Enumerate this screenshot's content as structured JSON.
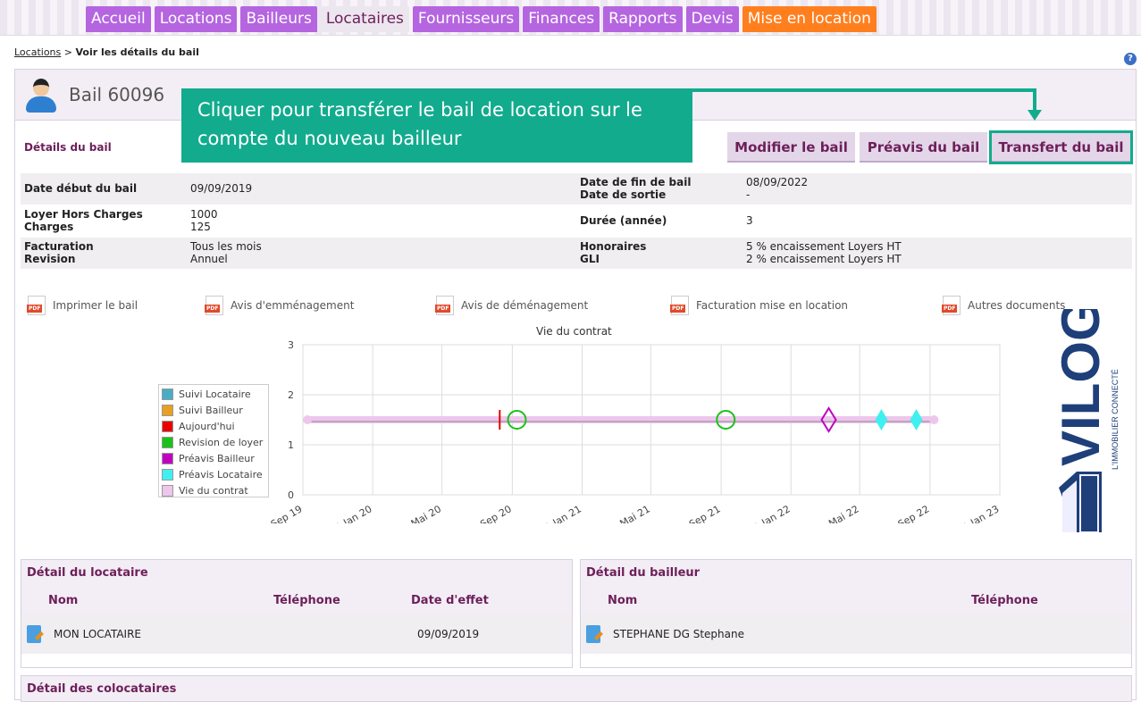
{
  "nav": [
    {
      "label": "Accueil",
      "color": "#b565e0"
    },
    {
      "label": "Locations",
      "color": "#b565e0"
    },
    {
      "label": "Bailleurs",
      "color": "#b565e0"
    },
    {
      "label": "Locataires",
      "color": "#ece6ef",
      "active": true
    },
    {
      "label": "Fournisseurs",
      "color": "#b565e0"
    },
    {
      "label": "Finances",
      "color": "#b565e0"
    },
    {
      "label": "Rapports",
      "color": "#b565e0"
    },
    {
      "label": "Devis",
      "color": "#b565e0"
    },
    {
      "label": "Mise en location",
      "color": "#ff7f1f"
    }
  ],
  "breadcrumb": {
    "link": "Locations",
    "sep": " > ",
    "current": "Voir les détails du bail"
  },
  "help_icon": "?",
  "header": {
    "title": "Bail 60096"
  },
  "callout": {
    "text": "Cliquer pour transférer le bail de location sur le compte du nouveau bailleur",
    "color": "#12ab8e"
  },
  "details_label": "Détails du bail",
  "buttons": {
    "modify": "Modifier le bail",
    "preavis": "Préavis du bail",
    "transfer": "Transfert du bail"
  },
  "info": {
    "date_debut_label": "Date début du bail",
    "date_debut": "09/09/2019",
    "date_fin_label": "Date de fin de bail",
    "date_fin": "08/09/2022",
    "date_sortie_label": "Date de sortie",
    "date_sortie": "-",
    "loyer_label": "Loyer Hors Charges",
    "loyer": "1000",
    "charges_label": "Charges",
    "charges": "125",
    "duree_label": "Durée (année)",
    "duree": "3",
    "facturation_label": "Facturation",
    "facturation": "Tous les mois",
    "revision_label": "Revision",
    "revision": "Annuel",
    "honoraires_label": "Honoraires",
    "honoraires": "5 % encaissement Loyers HT",
    "gli_label": "GLI",
    "gli": "2 % encaissement Loyers HT"
  },
  "documents": [
    {
      "label": "Imprimer le bail"
    },
    {
      "label": "Avis d'emménagement"
    },
    {
      "label": "Avis de déménagement"
    },
    {
      "label": "Facturation mise en location"
    },
    {
      "label": "Autres documents"
    }
  ],
  "chart_data": {
    "type": "line",
    "title": "Vie du contrat",
    "xlabel": "",
    "ylabel": "",
    "x_ticks": [
      "1 Sep 19",
      "1 Jan 20",
      "1 Mai 20",
      "1 Sep 20",
      "1 Jan 21",
      "1 Mai 21",
      "1 Sep 21",
      "1 Jan 22",
      "1 Mai 22",
      "1 Sep 22",
      "1 Jan 23"
    ],
    "xlim": [
      "2019-09-01",
      "2023-01-01"
    ],
    "ylim": [
      0,
      3
    ],
    "y_ticks": [
      0,
      1,
      2,
      3
    ],
    "grid": true,
    "legend_position": "left",
    "series": [
      {
        "name": "Suivi Locataire",
        "color": "#4bacc6",
        "points": []
      },
      {
        "name": "Suivi Bailleur",
        "color": "#e8a020",
        "points": []
      },
      {
        "name": "Aujourd'hui",
        "color": "#e80000",
        "marker": "tick",
        "points": [
          {
            "x": "2020-08-10",
            "y": 1.5
          }
        ]
      },
      {
        "name": "Revision de loyer",
        "color": "#19c219",
        "marker": "circle",
        "points": [
          {
            "x": "2020-09-09",
            "y": 1.5
          },
          {
            "x": "2021-09-09",
            "y": 1.5
          }
        ]
      },
      {
        "name": "Préavis Bailleur",
        "color": "#c000c0",
        "marker": "diamond",
        "points": [
          {
            "x": "2022-03-08",
            "y": 1.5
          }
        ]
      },
      {
        "name": "Préavis Locataire",
        "color": "#40f0f0",
        "marker": "triangle",
        "points": [
          {
            "x": "2022-06-08",
            "y": 1.5
          },
          {
            "x": "2022-08-08",
            "y": 1.5
          }
        ]
      },
      {
        "name": "Vie du contrat",
        "color": "#eec6ec",
        "marker": "line",
        "points": [
          {
            "x": "2019-09-09",
            "y": 1.5
          },
          {
            "x": "2022-09-08",
            "y": 1.5
          }
        ]
      }
    ]
  },
  "logo": {
    "text": "VILOGI",
    "tagline": "L'IMMOBILIER CONNECTÉ",
    "color": "#1e3f7a"
  },
  "locataire": {
    "title": "Détail du locataire",
    "headers": [
      "Nom",
      "Téléphone",
      "Date d'effet"
    ],
    "row": {
      "nom": "MON LOCATAIRE",
      "telephone": "",
      "date": "09/09/2019"
    }
  },
  "bailleur": {
    "title": "Détail du bailleur",
    "headers": [
      "Nom",
      "Téléphone"
    ],
    "row": {
      "nom": "STEPHANE DG Stephane",
      "telephone": ""
    }
  },
  "colocataires": {
    "title": "Détail des colocataires"
  }
}
